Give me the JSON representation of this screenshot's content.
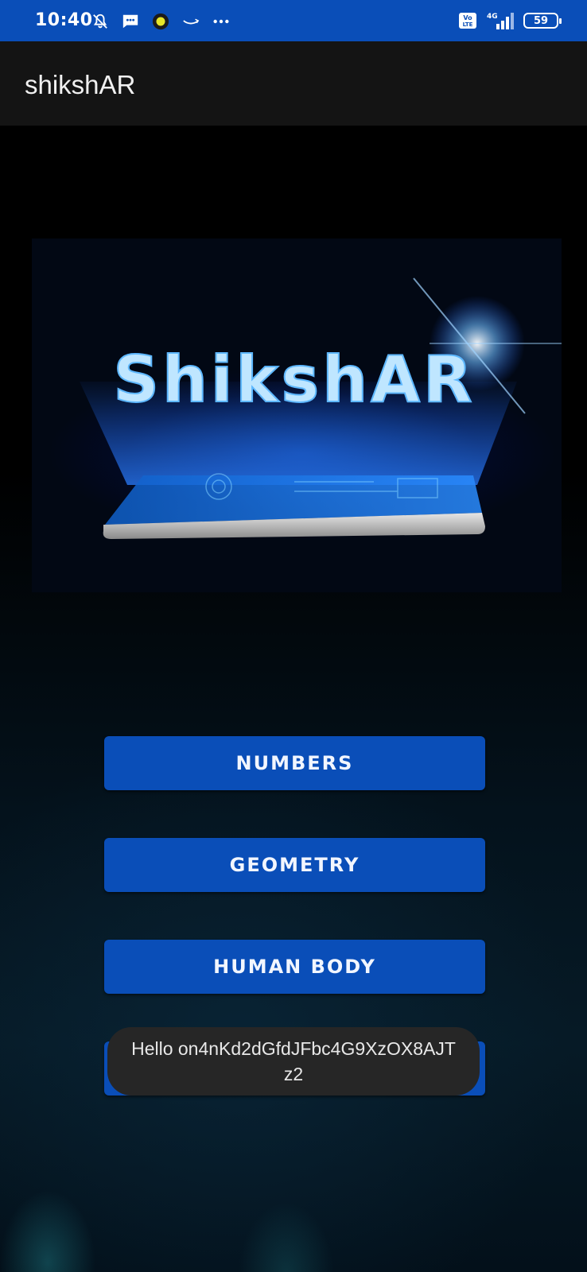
{
  "status_bar": {
    "time": "10:40",
    "battery_level": "59",
    "network": "4G",
    "volte": "Vo LTE",
    "left_icons": [
      "mute-bell-icon",
      "message-icon",
      "record-dot-icon",
      "amazon-smile-icon",
      "more-dots-icon"
    ],
    "right_icons": [
      "volte-icon",
      "signal-icon",
      "battery-icon"
    ]
  },
  "app_bar": {
    "title": "shikshAR"
  },
  "hero": {
    "logo_text": "ShikshAR"
  },
  "menu": {
    "items": [
      {
        "label": "NUMBERS"
      },
      {
        "label": "GEOMETRY"
      },
      {
        "label": "HUMAN BODY"
      },
      {
        "label": ""
      }
    ]
  },
  "toast": {
    "message": "Hello on4nKd2dGfdJFbc4G9XzOX8AJTz2"
  },
  "colors": {
    "status_bar": "#0a4eb8",
    "app_bar": "#141414",
    "button": "#0a4eb8",
    "toast": "#262626"
  }
}
